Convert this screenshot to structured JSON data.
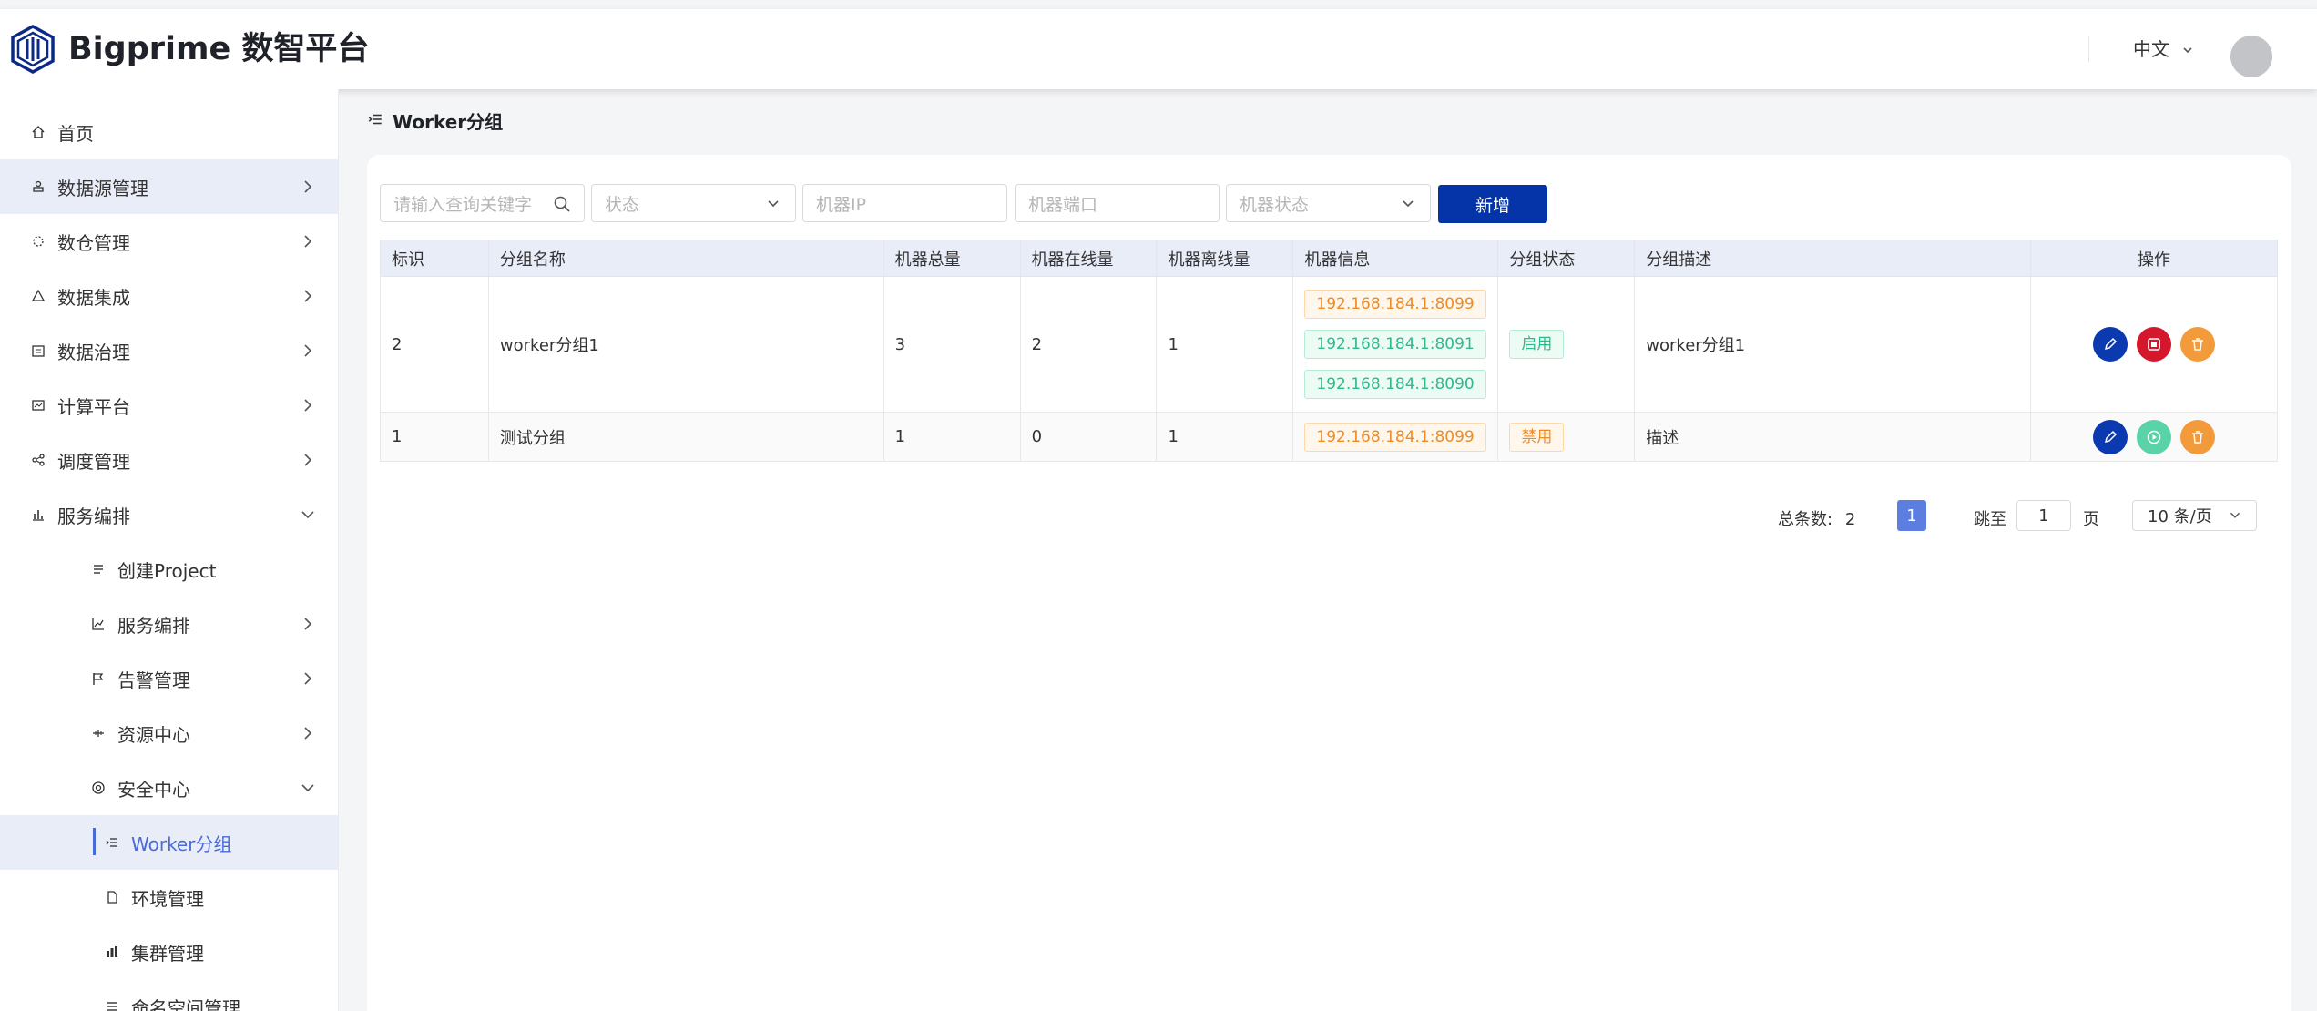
{
  "header": {
    "brand": "Bigprime 数智平台",
    "language": "中文"
  },
  "sidebar": {
    "items": [
      {
        "label": "首页",
        "icon": "home-icon"
      },
      {
        "label": "数据源管理",
        "icon": "database-icon"
      },
      {
        "label": "数仓管理",
        "icon": "warehouse-icon"
      },
      {
        "label": "数据集成",
        "icon": "integration-icon"
      },
      {
        "label": "数据治理",
        "icon": "governance-icon"
      },
      {
        "label": "计算平台",
        "icon": "compute-icon"
      },
      {
        "label": "调度管理",
        "icon": "share-icon"
      },
      {
        "label": "服务编排",
        "icon": "bar-chart-icon"
      },
      {
        "label": "创建Project",
        "icon": "list-icon"
      },
      {
        "label": "服务编排",
        "icon": "line-chart-icon"
      },
      {
        "label": "告警管理",
        "icon": "flag-icon"
      },
      {
        "label": "资源中心",
        "icon": "resource-icon"
      },
      {
        "label": "安全中心",
        "icon": "target-icon"
      },
      {
        "label": "Worker分组",
        "icon": "indent-icon"
      },
      {
        "label": "环境管理",
        "icon": "file-icon"
      },
      {
        "label": "集群管理",
        "icon": "cluster-icon"
      },
      {
        "label": "命名空间管理",
        "icon": "namespace-icon"
      }
    ]
  },
  "page": {
    "title": "Worker分组"
  },
  "filters": {
    "keyword_placeholder": "请输入查询关键字",
    "status_placeholder": "状态",
    "ip_placeholder": "机器IP",
    "port_placeholder": "机器端口",
    "machine_status_placeholder": "机器状态",
    "add_label": "新增"
  },
  "table": {
    "headers": [
      "标识",
      "分组名称",
      "机器总量",
      "机器在线量",
      "机器离线量",
      "机器信息",
      "分组状态",
      "分组描述",
      "操作"
    ],
    "rows": [
      {
        "id": "2",
        "name": "worker分组1",
        "total": "3",
        "online": "2",
        "offline": "1",
        "machines": [
          "192.168.184.1:8099",
          "192.168.184.1:8091",
          "192.168.184.1:8090"
        ],
        "status": "启用",
        "description": "worker分组1"
      },
      {
        "id": "1",
        "name": "测试分组",
        "total": "1",
        "online": "0",
        "offline": "1",
        "machines": [
          "192.168.184.1:8099"
        ],
        "status": "禁用",
        "description": "描述"
      }
    ]
  },
  "pagination": {
    "total_label": "总条数:",
    "total": "2",
    "current_page": "1",
    "jump_label": "跳至",
    "jump_value": "1",
    "page_unit": "页",
    "page_size": "10 条/页"
  },
  "colors": {
    "primary": "#0533a8",
    "accent": "#4a6ad8",
    "green": "#36b37e",
    "orange": "#f08a24",
    "danger": "#d4172a"
  }
}
